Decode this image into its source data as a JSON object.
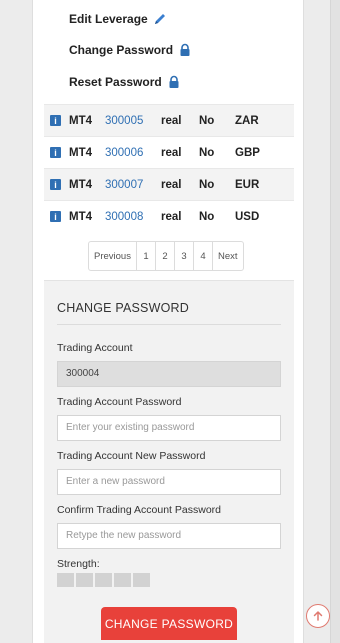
{
  "actions": {
    "edit_leverage": "Edit Leverage",
    "change_password": "Change Password",
    "reset_password": "Reset Password"
  },
  "accounts": [
    {
      "platform": "MT4",
      "number": "300005",
      "type": "real",
      "demo": "No",
      "currency": "ZAR"
    },
    {
      "platform": "MT4",
      "number": "300006",
      "type": "real",
      "demo": "No",
      "currency": "GBP"
    },
    {
      "platform": "MT4",
      "number": "300007",
      "type": "real",
      "demo": "No",
      "currency": "EUR"
    },
    {
      "platform": "MT4",
      "number": "300008",
      "type": "real",
      "demo": "No",
      "currency": "USD"
    }
  ],
  "pagination": {
    "previous": "Previous",
    "pages": [
      "1",
      "2",
      "3",
      "4"
    ],
    "next": "Next"
  },
  "form": {
    "title": "CHANGE PASSWORD",
    "account_label": "Trading Account",
    "account_value": "300004",
    "current_label": "Trading Account Password",
    "current_placeholder": "Enter your existing password",
    "new_label": "Trading Account New Password",
    "new_placeholder": "Enter a new password",
    "confirm_label": "Confirm Trading Account Password",
    "confirm_placeholder": "Retype the new password",
    "strength_label": "Strength:",
    "submit_label": "CHANGE PASSWORD"
  },
  "colors": {
    "link_blue": "#2f6fb3",
    "submit_red": "#e8413a",
    "icon_blue": "#2f6fb3"
  },
  "icons": {
    "edit": "pencil-icon",
    "lock": "lock-icon",
    "info": "info-icon",
    "scroll_top": "arrow-up-circle-icon"
  }
}
